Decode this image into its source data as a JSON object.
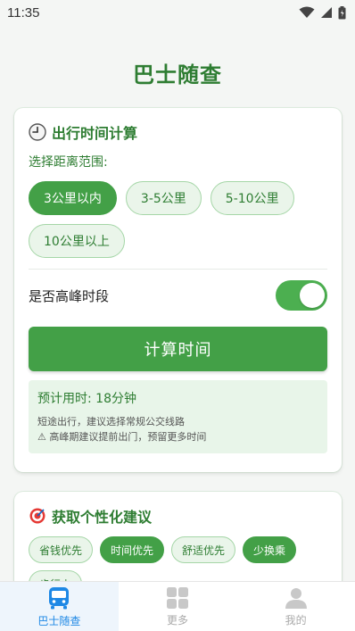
{
  "status": {
    "time": "11:35"
  },
  "app": {
    "title": "巴士随查"
  },
  "card1": {
    "title": "出行时间计算",
    "distance_label": "选择距离范围:",
    "distances": [
      {
        "label": "3公里以内",
        "active": true
      },
      {
        "label": "3-5公里",
        "active": false
      },
      {
        "label": "5-10公里",
        "active": false
      },
      {
        "label": "10公里以上",
        "active": false
      }
    ],
    "peak_label": "是否高峰时段",
    "peak_on": true,
    "calc_button": "计算时间",
    "result": {
      "estimate": "预计用时: 18分钟",
      "tip1": "短途出行，建议选择常规公交线路",
      "tip2": "⚠ 高峰期建议提前出门，预留更多时间"
    }
  },
  "card2": {
    "title": "获取个性化建议",
    "prefs": [
      {
        "label": "省钱优先",
        "active": false
      },
      {
        "label": "时间优先",
        "active": true
      },
      {
        "label": "舒适优先",
        "active": false
      },
      {
        "label": "少换乘",
        "active": true
      },
      {
        "label": "步行少",
        "active": false
      }
    ]
  },
  "nav": {
    "items": [
      {
        "label": "巴士随查",
        "icon": "bus-icon",
        "active": true
      },
      {
        "label": "更多",
        "icon": "grid-icon",
        "active": false
      },
      {
        "label": "我的",
        "icon": "person-icon",
        "active": false
      }
    ]
  },
  "colors": {
    "primary": "#43a047",
    "primary_dark": "#2e7d32",
    "nav_active": "#1e88e5"
  }
}
